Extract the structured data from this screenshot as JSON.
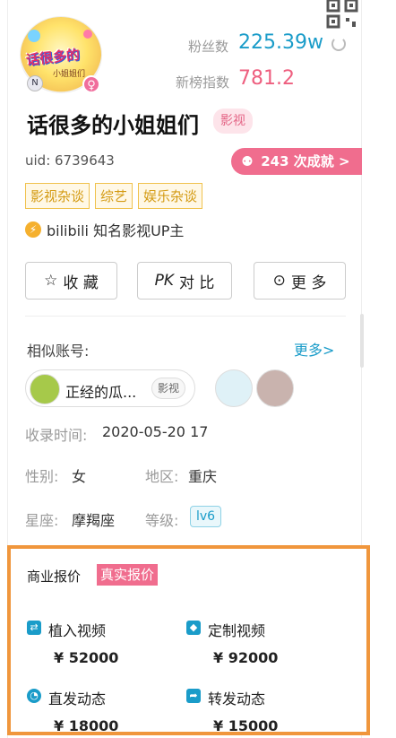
{
  "profile": {
    "avatar_text": "话很多的",
    "avatar_sub": "小姐姐们",
    "n_badge": "N",
    "gender_symbol": "♀",
    "name": "话很多的小姐姐们",
    "type_tag": "影视",
    "uid": "uid: 6739643",
    "achievements": "243 次成就",
    "achievements_chevron": ">",
    "category_tags": [
      "影视杂谈",
      "综艺",
      "娱乐杂谈"
    ],
    "verification": "bilibili 知名影视UP主"
  },
  "stats": {
    "fans_label": "粉丝数",
    "fans_value": "225.39w",
    "rank_label": "新榜指数",
    "rank_value": "781.2"
  },
  "actions": {
    "favorite": "收 藏",
    "compare_prefix": "PK",
    "compare": "对 比",
    "more": "更 多"
  },
  "similar": {
    "title": "相似账号:",
    "more": "更多>",
    "first_name": "正经的瓜...",
    "first_tag": "影视"
  },
  "info": {
    "recorded_label": "收录时间:",
    "recorded_value": "2020-05-20 17",
    "gender_label": "性别:",
    "gender_value": "女",
    "region_label": "地区:",
    "region_value": "重庆",
    "zodiac_label": "星座:",
    "zodiac_value": "摩羯座",
    "level_label": "等级:",
    "level_value": "lv6"
  },
  "business": {
    "title": "商业报价",
    "tag": "真实报价",
    "items": [
      {
        "label": "植入视频",
        "price": "¥ 52000",
        "icon": "embed-video-icon",
        "color": "#1a9cc9"
      },
      {
        "label": "定制视频",
        "price": "¥ 92000",
        "icon": "custom-video-icon",
        "color": "#1a9cc9"
      },
      {
        "label": "直发动态",
        "price": "¥ 18000",
        "icon": "direct-post-icon",
        "color": "#1a9cc9"
      },
      {
        "label": "转发动态",
        "price": "¥ 15000",
        "icon": "repost-icon",
        "color": "#1a9cc9"
      }
    ]
  },
  "colors": {
    "accent_blue": "#1a9cc9",
    "accent_pink": "#f06d8e",
    "highlight_orange": "#f0963c"
  }
}
